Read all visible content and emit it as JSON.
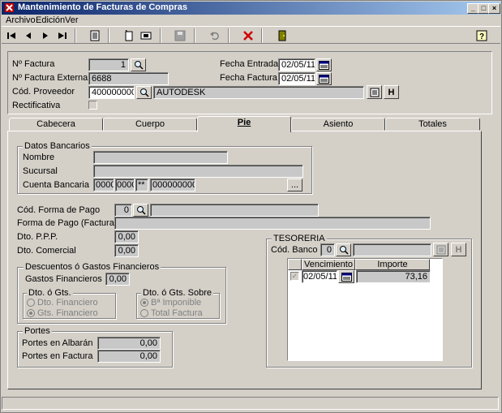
{
  "window": {
    "title": "Mantenimiento de Facturas de Compras"
  },
  "menu": [
    "Archivo",
    "Edición",
    "Ver"
  ],
  "header": {
    "n_factura_label": "Nº Factura",
    "n_factura_value": "1",
    "n_factura_externa_label": "Nº Factura Externa",
    "n_factura_externa_value": "6688",
    "cod_proveedor_label": "Cód. Proveedor",
    "cod_proveedor_value": "4000000002",
    "proveedor_nombre": "AUTODESK",
    "rectificativa_label": "Rectificativa",
    "fecha_entrada_label": "Fecha Entrada",
    "fecha_entrada_value": "02/05/11",
    "fecha_factura_label": "Fecha Factura",
    "fecha_factura_value": "02/05/11",
    "h_button": "H"
  },
  "tabs": [
    "Cabecera",
    "Cuerpo",
    "Pie",
    "Asiento",
    "Totales"
  ],
  "datos_bancarios": {
    "title": "Datos Bancarios",
    "nombre_label": "Nombre",
    "nombre_value": "",
    "sucursal_label": "Sucursal",
    "sucursal_value": "",
    "cuenta_label": "Cuenta Bancaria",
    "cuenta_entidad": "0000",
    "cuenta_oficina": "0000",
    "cuenta_dc": "**",
    "cuenta_numero": "0000000000",
    "more_button": "..."
  },
  "pago": {
    "cod_forma_label": "Cód. Forma de Pago",
    "cod_forma_value": "0",
    "forma_factura_label": "Forma de Pago (Factura)",
    "forma_factura_value": "",
    "dto_ppp_label": "Dto. P.P.P.",
    "dto_ppp_value": "0,00",
    "dto_comercial_label": "Dto. Comercial",
    "dto_comercial_value": "0,00"
  },
  "descuentos": {
    "title": "Descuentos ó Gastos Financieros",
    "gastos_label": "Gastos Financieros",
    "gastos_value": "0,00",
    "dto_gts_title": "Dto. ó Gts.",
    "dto_financiero": "Dto. Financiero",
    "gts_financiero": "Gts. Financiero",
    "dto_sobre_title": "Dto. ó Gts. Sobre",
    "base_imponible": "Bª Imponible",
    "total_factura": "Total Factura"
  },
  "portes": {
    "title": "Portes",
    "albaran_label": "Portes en Albarán",
    "albaran_value": "0,00",
    "factura_label": "Portes en Factura",
    "factura_value": "0,00"
  },
  "tesoreria": {
    "title": "TESORERIA",
    "cod_banco_label": "Cód. Banco",
    "cod_banco_value": "0",
    "h_button": "H",
    "columns": [
      "Vencimiento",
      "Importe"
    ],
    "rows": [
      {
        "vencimiento": "02/05/11",
        "importe": "73,16"
      }
    ]
  }
}
